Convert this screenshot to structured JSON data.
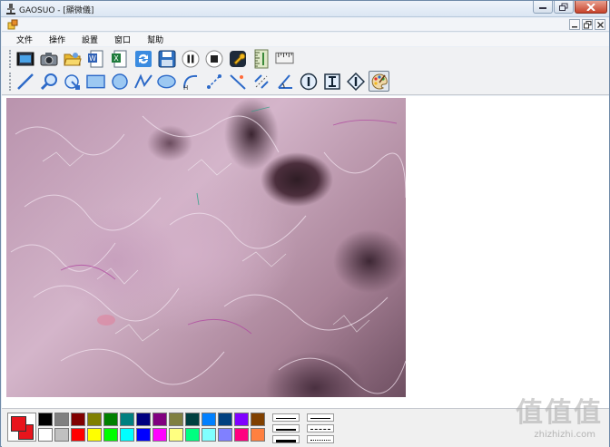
{
  "window": {
    "title": "GAOSUO - [顯微儀]"
  },
  "menu": {
    "items": [
      "文件",
      "操作",
      "設置",
      "窗口",
      "幫助"
    ]
  },
  "toolbar": {
    "row1_icons": [
      "video-camera-icon",
      "camera-icon",
      "open-folder-icon",
      "word-export-icon",
      "excel-export-icon",
      "refresh-icon",
      "save-icon",
      "pause-icon",
      "stop-icon",
      "wrench-icon",
      "vertical-ruler-icon",
      "horizontal-ruler-icon"
    ],
    "row2_icons": [
      "line-tool-icon",
      "magnifier-icon",
      "rotate-tool-icon",
      "rectangle-tool-icon",
      "circle-tool-icon",
      "polyline-tool-icon",
      "ellipse-tool-icon",
      "arc-tool-icon",
      "distance-tool-icon",
      "point-line-tool-icon",
      "parallel-tool-icon",
      "angle-tool-icon",
      "info-i-icon",
      "text-i-icon",
      "diamond-i-icon",
      "palette-icon"
    ],
    "selected": "palette-icon"
  },
  "palette": {
    "foreground": "#e8141c",
    "background": "#e8141c",
    "colors": [
      "#000000",
      "#808080",
      "#800000",
      "#808000",
      "#008000",
      "#008080",
      "#000080",
      "#800080",
      "#808040",
      "#004040",
      "#0080ff",
      "#004080",
      "#8000ff",
      "#804000",
      "#ffffff",
      "#c0c0c0",
      "#ff0000",
      "#ffff00",
      "#00ff00",
      "#00ffff",
      "#0000ff",
      "#ff00ff",
      "#ffff80",
      "#00ff80",
      "#80ffff",
      "#8080ff",
      "#ff0080",
      "#ff8040"
    ]
  },
  "watermark": {
    "logo": "值值值",
    "url": "zhizhizhi.com"
  }
}
